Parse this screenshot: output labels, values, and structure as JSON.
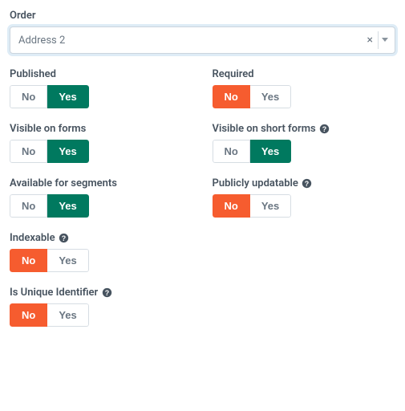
{
  "labels": {
    "no": "No",
    "yes": "Yes"
  },
  "order": {
    "label": "Order",
    "value": "Address 2"
  },
  "fields": {
    "published": {
      "label": "Published",
      "value": "yes",
      "help": false
    },
    "required": {
      "label": "Required",
      "value": "no",
      "help": false
    },
    "visible_forms": {
      "label": "Visible on forms",
      "value": "yes",
      "help": false
    },
    "visible_short_forms": {
      "label": "Visible on short forms",
      "value": "yes",
      "help": true
    },
    "available_segments": {
      "label": "Available for segments",
      "value": "yes",
      "help": false
    },
    "publicly_updatable": {
      "label": "Publicly updatable",
      "value": "no",
      "help": true
    },
    "indexable": {
      "label": "Indexable",
      "value": "no",
      "help": true
    },
    "unique_identifier": {
      "label": "Is Unique Identifier",
      "value": "no",
      "help": true
    }
  }
}
